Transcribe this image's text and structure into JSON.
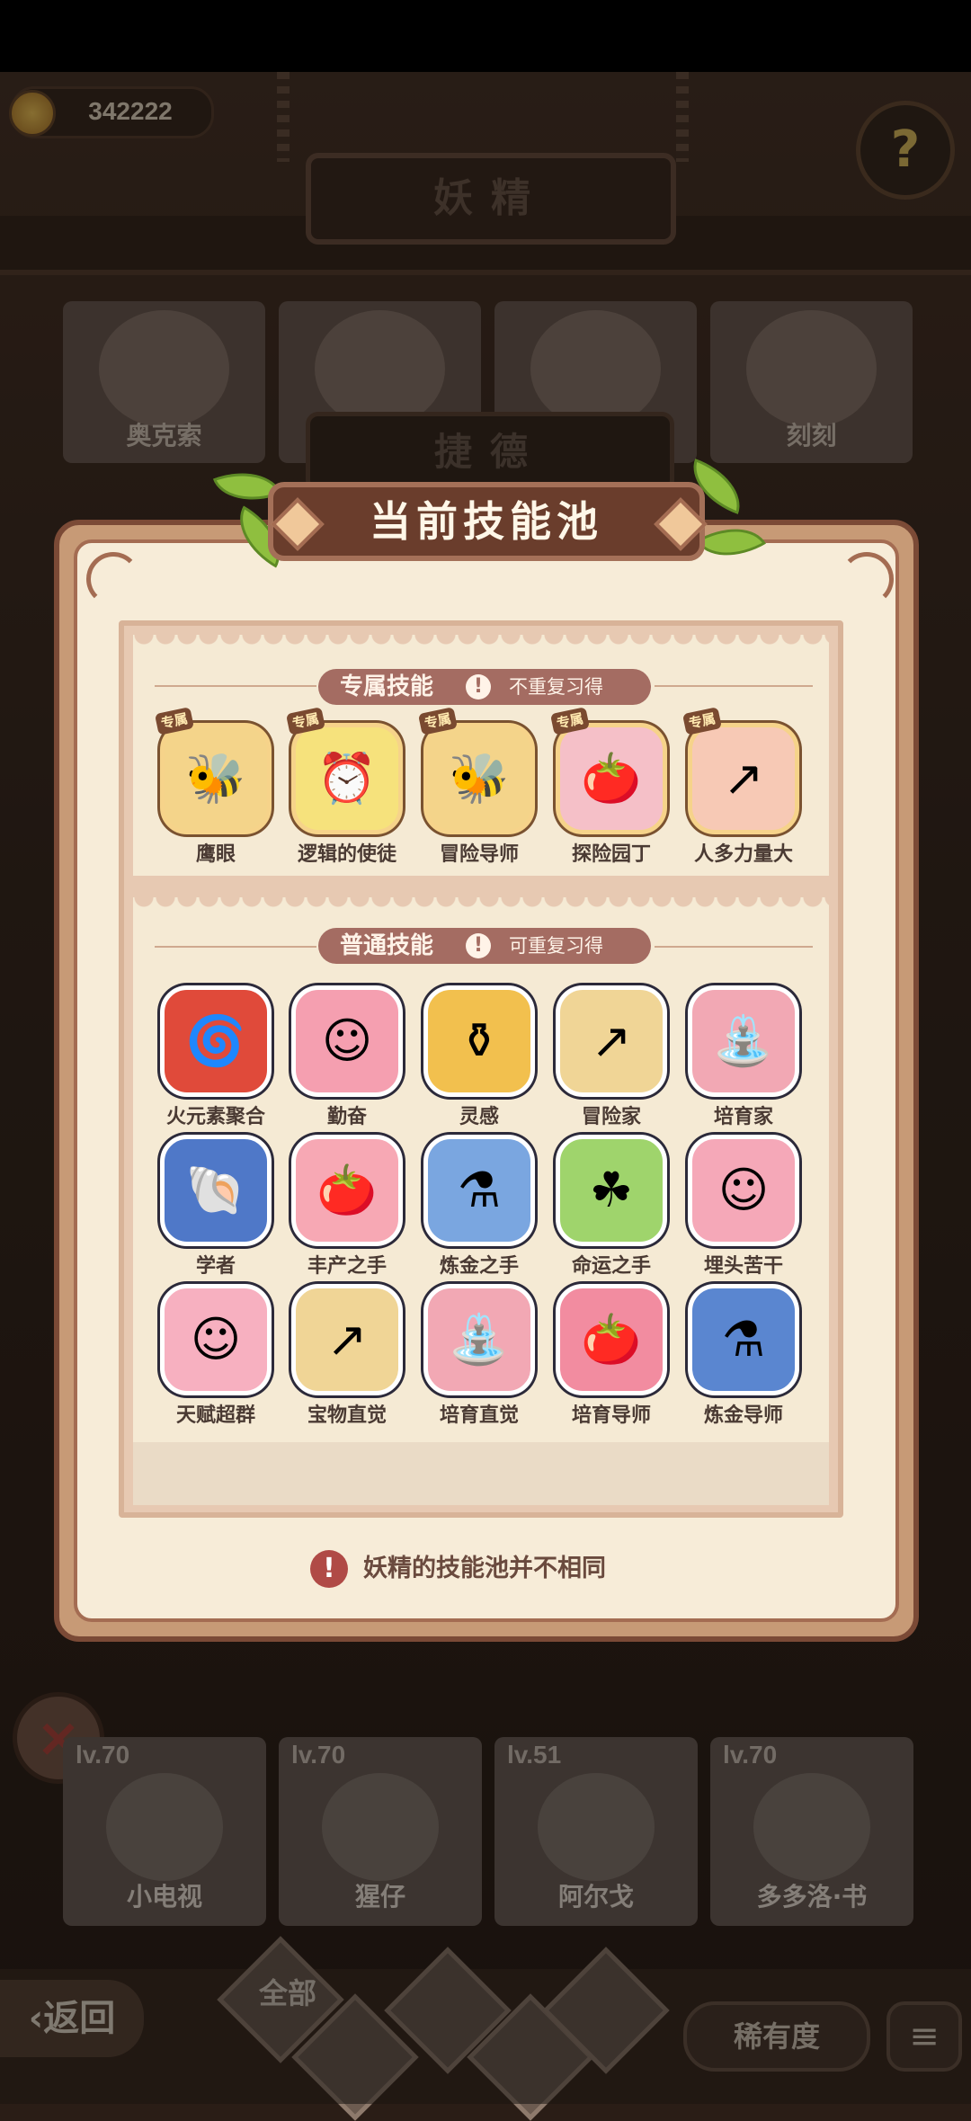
{
  "header": {
    "coins": "342222",
    "title": "妖精",
    "help_icon": "question-sprout-icon"
  },
  "fairies_top": [
    "奥克索",
    "",
    "",
    "刻刻"
  ],
  "selected_fairy_name": "捷德",
  "panel": {
    "title": "当前技能池",
    "exclusive": {
      "heading": "专属技能",
      "note": "不重复习得",
      "tag": "专属",
      "skills": [
        {
          "name": "鹰眼",
          "icon": "bee-icon",
          "bg": "#f4d48a"
        },
        {
          "name": "逻辑的使徒",
          "icon": "clock-icon",
          "bg": "#f6e27c"
        },
        {
          "name": "冒险导师",
          "icon": "bee-icon",
          "bg": "#f4d48a"
        },
        {
          "name": "探险园丁",
          "icon": "bee-tomato-icon",
          "bg": "#f5c0c8"
        },
        {
          "name": "人多力量大",
          "icon": "pouch-arrow-icon",
          "bg": "#f7c9b5"
        }
      ]
    },
    "normal": {
      "heading": "普通技能",
      "note": "可重复习得",
      "skills": [
        {
          "name": "火元素聚合",
          "icon": "fire-swirl-icon",
          "bg": "#e04a3a"
        },
        {
          "name": "勤奋",
          "icon": "pink-face-icon",
          "bg": "#f59fb0"
        },
        {
          "name": "灵感",
          "icon": "pot-icon",
          "bg": "#f2c04e"
        },
        {
          "name": "冒险家",
          "icon": "pouch-arrow-icon",
          "bg": "#f0d596"
        },
        {
          "name": "培育家",
          "icon": "watering-can-icon",
          "bg": "#f2a8b4"
        },
        {
          "name": "学者",
          "icon": "shell-icon",
          "bg": "#4f78c8"
        },
        {
          "name": "丰产之手",
          "icon": "tomato-icon",
          "bg": "#f7a8b4"
        },
        {
          "name": "炼金之手",
          "icon": "cauldron-icon",
          "bg": "#7aa6e0"
        },
        {
          "name": "命运之手",
          "icon": "clover-icon",
          "bg": "#9fd46c"
        },
        {
          "name": "埋头苦干",
          "icon": "pink-face-icon",
          "bg": "#f5a8b8"
        },
        {
          "name": "天赋超群",
          "icon": "pink-face-icon",
          "bg": "#f7b0c0"
        },
        {
          "name": "宝物直觉",
          "icon": "pouch-arrow-icon",
          "bg": "#f0d596"
        },
        {
          "name": "培育直觉",
          "icon": "watering-can-icon",
          "bg": "#f2a8b4"
        },
        {
          "name": "培育导师",
          "icon": "tomato-icon",
          "bg": "#f28ca0"
        },
        {
          "name": "炼金导师",
          "icon": "cauldron-icon",
          "bg": "#5a86d0"
        }
      ]
    },
    "footer_note": "妖精的技能池并不相同"
  },
  "bottom_cards": [
    {
      "lv": "lv.70",
      "name": "小电视"
    },
    {
      "lv": "lv.70",
      "name": "猩仔"
    },
    {
      "lv": "lv.51",
      "name": "阿尔戈"
    },
    {
      "lv": "lv.70",
      "name": "多多洛·书"
    }
  ],
  "bottom_bar": {
    "back_label": "返回",
    "filter_all": "全部",
    "rarity_label": "稀有度"
  }
}
